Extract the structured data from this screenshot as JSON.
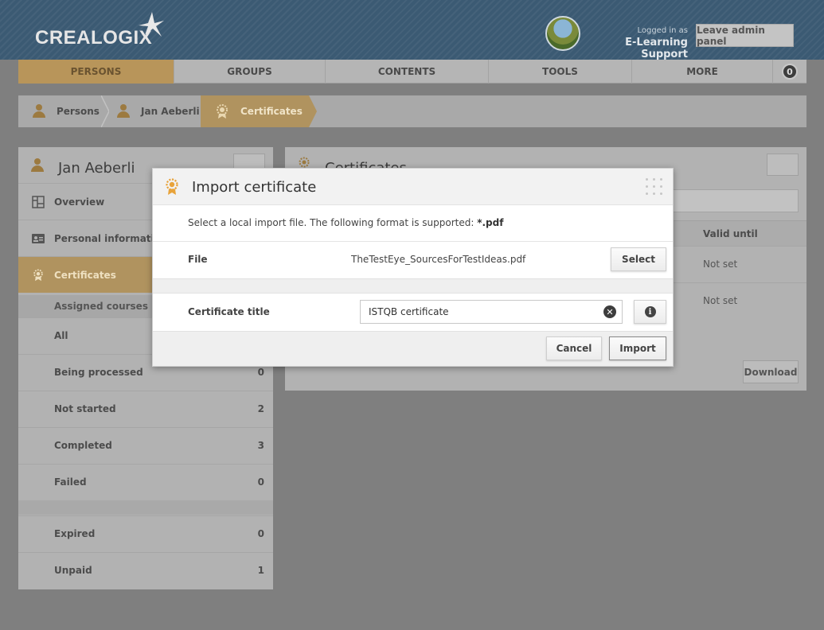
{
  "header": {
    "logo": "CREALOGIX",
    "logged_in_label": "Logged in as",
    "user_name": "E-Learning Support",
    "leave_button": "Leave admin panel"
  },
  "nav": {
    "items": [
      "PERSONS",
      "GROUPS",
      "CONTENTS",
      "TOOLS",
      "MORE"
    ],
    "active": "PERSONS",
    "badge": "0"
  },
  "breadcrumb": [
    "Persons",
    "Jan Aeberli",
    "Certificates"
  ],
  "left_panel": {
    "title": "Jan Aeberli",
    "items": [
      "Overview",
      "Personal information",
      "Certificates"
    ],
    "active": "Certificates",
    "section_title": "Assigned courses",
    "rows": [
      {
        "label": "All",
        "count": ""
      },
      {
        "label": "Being processed",
        "count": "0"
      },
      {
        "label": "Not started",
        "count": "2"
      },
      {
        "label": "Completed",
        "count": "3"
      },
      {
        "label": "Failed",
        "count": "0"
      }
    ],
    "rows2": [
      {
        "label": "Expired",
        "count": "0"
      },
      {
        "label": "Unpaid",
        "count": "1"
      }
    ]
  },
  "right_panel": {
    "title": "Certificates",
    "column_valid_until": "Valid until",
    "rows": [
      "Not set",
      "Not set"
    ],
    "download_button": "Download"
  },
  "dialog": {
    "title": "Import certificate",
    "info_text": "Select a local import file. The following format is supported: ",
    "info_format": "*.pdf",
    "file_label": "File",
    "file_name": "TheTestEye_SourcesForTestIdeas.pdf",
    "select_button": "Select",
    "cert_title_label": "Certificate title",
    "cert_title_value": "ISTQB certificate",
    "cancel_button": "Cancel",
    "import_button": "Import"
  },
  "colors": {
    "accent": "#e8a33a",
    "header_bg": "#3b5a73",
    "overlay": "#7f7f7f"
  }
}
